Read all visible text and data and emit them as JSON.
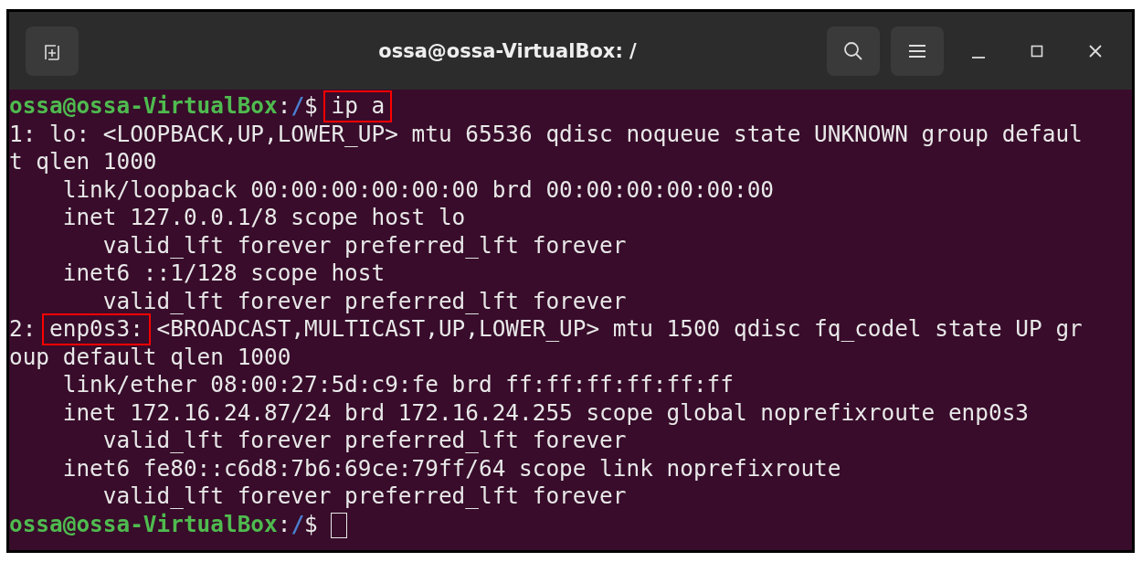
{
  "window": {
    "title": "ossa@ossa-VirtualBox: /"
  },
  "lines": [
    {
      "kind": "prompt",
      "user_host": "ossa@ossa-VirtualBox",
      "separator": ":",
      "path": "/",
      "symbol": "$",
      "command": "ip a",
      "command_highlighted": true
    },
    {
      "kind": "output",
      "segments": [
        {
          "text": "1: lo: <LOOPBACK,UP,LOWER_UP> mtu 65536 qdisc noqueue state UNKNOWN group defaul",
          "highlighted": false
        }
      ]
    },
    {
      "kind": "output",
      "segments": [
        {
          "text": "t qlen 1000",
          "highlighted": false
        }
      ]
    },
    {
      "kind": "output",
      "segments": [
        {
          "text": "    link/loopback 00:00:00:00:00:00 brd 00:00:00:00:00:00",
          "highlighted": false
        }
      ]
    },
    {
      "kind": "output",
      "segments": [
        {
          "text": "    inet 127.0.0.1/8 scope host lo",
          "highlighted": false
        }
      ]
    },
    {
      "kind": "output",
      "segments": [
        {
          "text": "       valid_lft forever preferred_lft forever",
          "highlighted": false
        }
      ]
    },
    {
      "kind": "output",
      "segments": [
        {
          "text": "    inet6 ::1/128 scope host",
          "highlighted": false
        }
      ]
    },
    {
      "kind": "output",
      "segments": [
        {
          "text": "       valid_lft forever preferred_lft forever",
          "highlighted": false
        }
      ]
    },
    {
      "kind": "output",
      "segments": [
        {
          "text": "2: ",
          "highlighted": false
        },
        {
          "text": "enp0s3:",
          "highlighted": true
        },
        {
          "text": " <BROADCAST,MULTICAST,UP,LOWER_UP> mtu 1500 qdisc fq_codel state UP gr",
          "highlighted": false
        }
      ]
    },
    {
      "kind": "output",
      "segments": [
        {
          "text": "oup default qlen 1000",
          "highlighted": false
        }
      ]
    },
    {
      "kind": "output",
      "segments": [
        {
          "text": "    link/ether 08:00:27:5d:c9:fe brd ff:ff:ff:ff:ff:ff",
          "highlighted": false
        }
      ]
    },
    {
      "kind": "output",
      "segments": [
        {
          "text": "    inet 172.16.24.87/24 brd 172.16.24.255 scope global noprefixroute enp0s3",
          "highlighted": false
        }
      ]
    },
    {
      "kind": "output",
      "segments": [
        {
          "text": "       valid_lft forever preferred_lft forever",
          "highlighted": false
        }
      ]
    },
    {
      "kind": "output",
      "segments": [
        {
          "text": "    inet6 fe80::c6d8:7b6:69ce:79ff/64 scope link noprefixroute",
          "highlighted": false
        }
      ]
    },
    {
      "kind": "output",
      "segments": [
        {
          "text": "       valid_lft forever preferred_lft forever",
          "highlighted": false
        }
      ]
    },
    {
      "kind": "prompt",
      "user_host": "ossa@ossa-VirtualBox",
      "separator": ":",
      "path": "/",
      "symbol": "$",
      "cursor": true
    }
  ]
}
